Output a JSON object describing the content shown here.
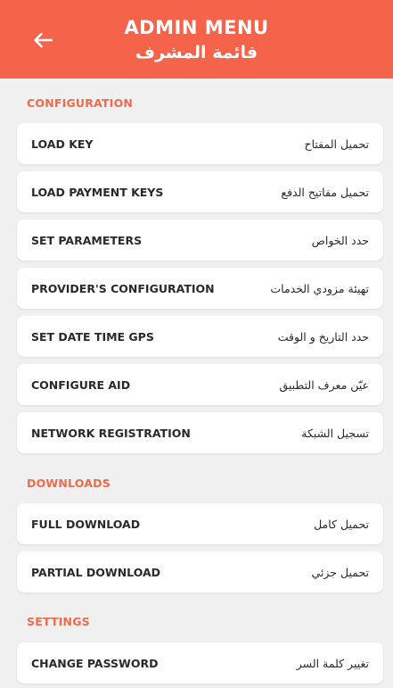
{
  "header": {
    "title_en": "ADMIN MENU",
    "title_ar": "قائمة المشرف",
    "back_icon": "arrow-left-icon",
    "color": "#f5634a"
  },
  "accent_color": "#f06a4c",
  "sections": {
    "configuration": {
      "title": "CONFIGURATION",
      "items": [
        {
          "en": "LOAD KEY",
          "ar": "تحميل المفتاح"
        },
        {
          "en": "LOAD PAYMENT KEYS",
          "ar": "تحميل مفاتيح الدفع"
        },
        {
          "en": "SET PARAMETERS",
          "ar": "حدد الخواص"
        },
        {
          "en": "PROVIDER'S CONFIGURATION",
          "ar": "تهيئة مزودي الخدمات"
        },
        {
          "en": "SET DATE TIME GPS",
          "ar": "حدد التاريخ و الوقت"
        },
        {
          "en": "CONFIGURE AID",
          "ar": "عيّن معرف التطبيق"
        },
        {
          "en": "NETWORK REGISTRATION",
          "ar": "تسجيل الشبكة"
        }
      ]
    },
    "downloads": {
      "title": "DOWNLOADS",
      "items": [
        {
          "en": "FULL DOWNLOAD",
          "ar": "تحميل كامل"
        },
        {
          "en": "PARTIAL DOWNLOAD",
          "ar": "تحميل جزئي"
        }
      ]
    },
    "settings": {
      "title": "SETTINGS",
      "items": [
        {
          "en": "CHANGE PASSWORD",
          "ar": "تغيير كلمة السر"
        }
      ]
    }
  }
}
